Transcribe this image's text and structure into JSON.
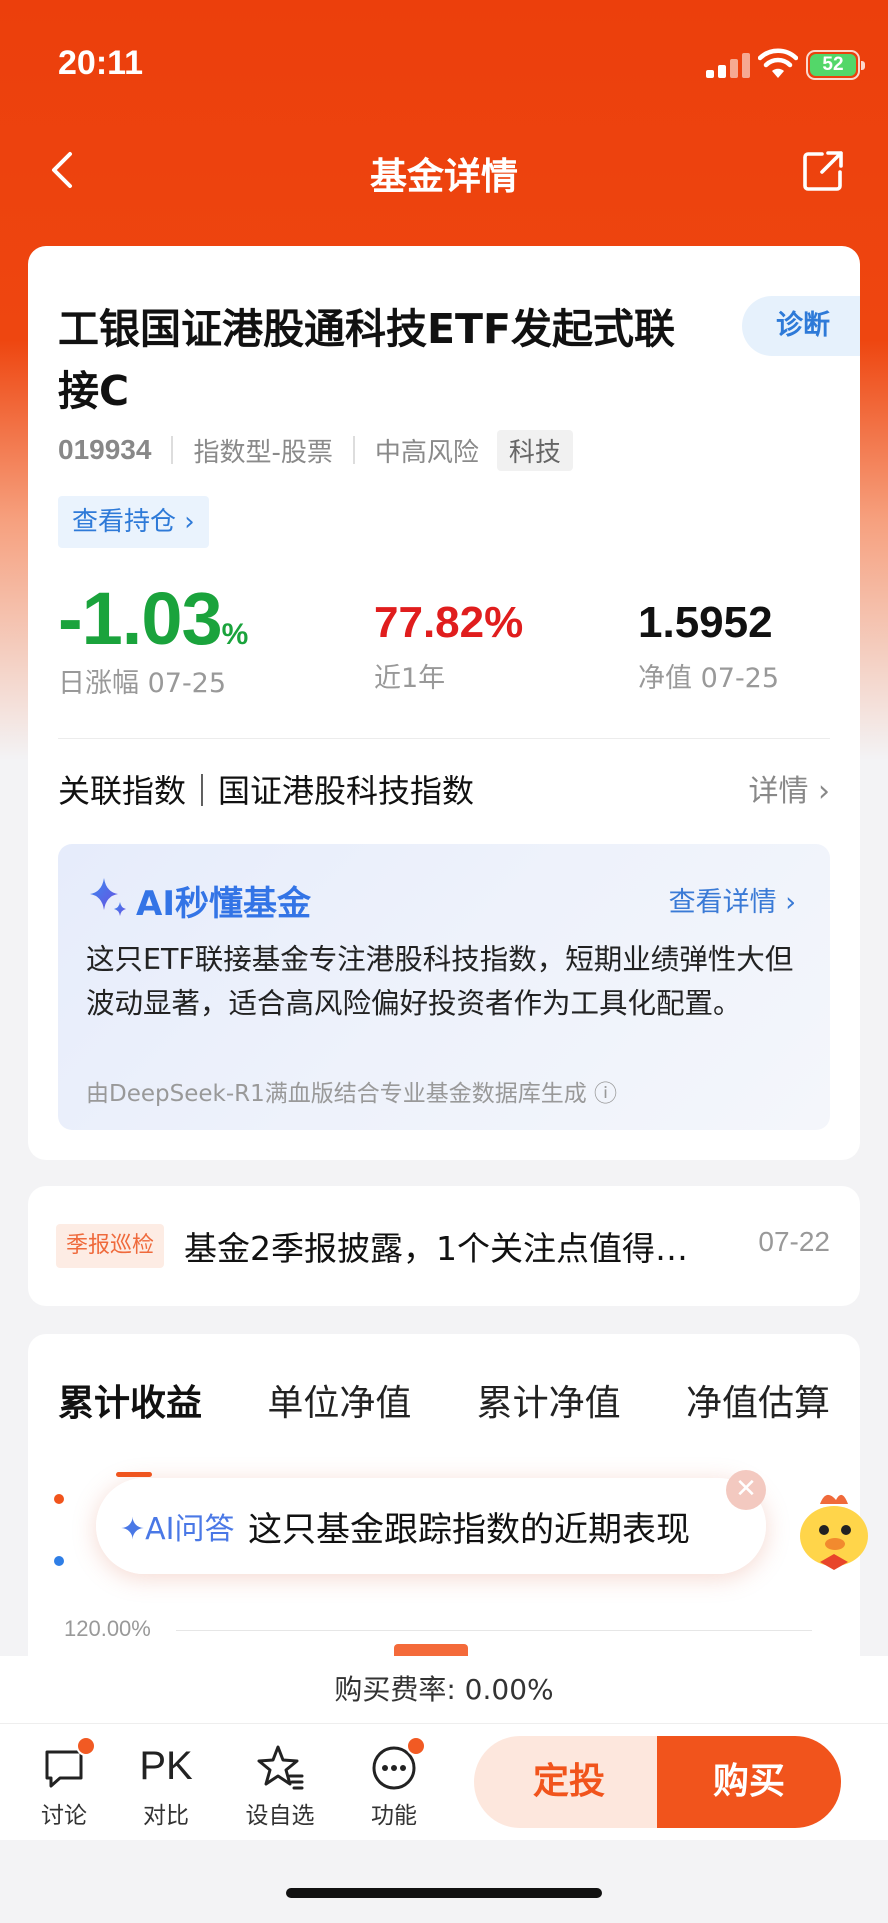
{
  "status": {
    "time": "20:11",
    "battery": "52"
  },
  "nav": {
    "title": "基金详情"
  },
  "fund": {
    "name": "工银国证港股通科技ETF发起式联接C",
    "diagnose_label": "诊断",
    "code": "019934",
    "type": "指数型-股票",
    "risk": "中高风险",
    "tag": "科技",
    "holdings_label": "查看持仓 ›"
  },
  "metrics": {
    "daily_change": "-1.03",
    "daily_change_unit": "%",
    "daily_label": "日涨幅 07-25",
    "year_return": "77.82%",
    "year_label": "近1年",
    "nav_value": "1.5952",
    "nav_label": "净值 07-25"
  },
  "index": {
    "text": "关联指数｜国证港股科技指数",
    "detail": "详情 ›"
  },
  "ai_summary": {
    "title": "AI秒懂基金",
    "more": "查看详情 ›",
    "text": "这只ETF联接基金专注港股科技指数，短期业绩弹性大但波动显著，适合高风险偏好投资者作为工具化配置。",
    "source": "由DeepSeek-R1满血版结合专业基金数据库生成 ⓘ"
  },
  "notice": {
    "tag": "季报巡检",
    "text": "基金2季报披露，1个关注点值得…",
    "date": "07-22"
  },
  "chart_tabs": [
    "累计收益",
    "单位净值",
    "累计净值",
    "净值估算"
  ],
  "chart": {
    "y_top": "120.00%"
  },
  "ai_question": {
    "label": "✦AI问答",
    "question": "这只基金跟踪指数的近期表现",
    "close": "✕"
  },
  "fee": {
    "text": "购买费率: 0.00%"
  },
  "bottom": {
    "discuss": "讨论",
    "pk_icon": "PK",
    "compare": "对比",
    "watch": "设自选",
    "functions": "功能",
    "plan": "定投",
    "buy": "购买"
  },
  "colors": {
    "brand": "#ee4610",
    "up": "#e01d1d",
    "down": "#1aa33c",
    "ai_blue": "#3374e6"
  }
}
